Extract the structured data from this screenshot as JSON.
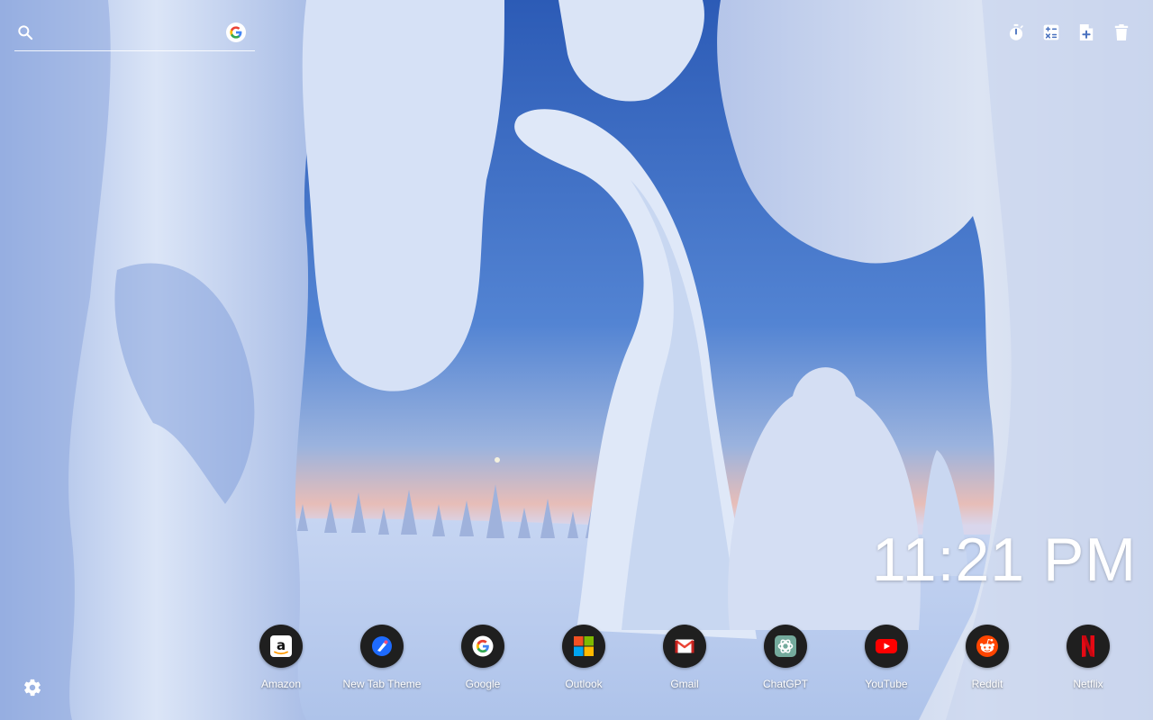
{
  "search": {
    "placeholder": "",
    "value": "",
    "engine_icon": "google-icon"
  },
  "tools": [
    {
      "name": "timer",
      "icon": "timer-icon"
    },
    {
      "name": "calculator",
      "icon": "calculator-icon"
    },
    {
      "name": "add-note",
      "icon": "add-note-icon"
    },
    {
      "name": "trash",
      "icon": "trash-icon"
    }
  ],
  "clock": {
    "time": "11:21 PM"
  },
  "shortcuts": [
    {
      "label": "Amazon",
      "icon": "amazon-icon",
      "color": "#ffffff"
    },
    {
      "label": "New Tab Theme",
      "icon": "new-tab-theme-icon",
      "color": "#1e6bff"
    },
    {
      "label": "Google",
      "icon": "google-icon",
      "color": "#4285f4"
    },
    {
      "label": "Outlook",
      "icon": "windows-icon",
      "color": "#f25022"
    },
    {
      "label": "Gmail",
      "icon": "gmail-icon",
      "color": "#ea4335"
    },
    {
      "label": "ChatGPT",
      "icon": "chatgpt-icon",
      "color": "#74aa9c"
    },
    {
      "label": "YouTube",
      "icon": "youtube-icon",
      "color": "#ff0000"
    },
    {
      "label": "Reddit",
      "icon": "reddit-icon",
      "color": "#ff4500"
    },
    {
      "label": "Netflix",
      "icon": "netflix-icon",
      "color": "#e50914"
    }
  ],
  "settings": {
    "icon": "gear-icon"
  },
  "colors": {
    "sky_top": "#2f5fb8",
    "sky_bottom": "#e9b9b6",
    "snow": "#dfe8f7",
    "text": "#ffffff"
  }
}
